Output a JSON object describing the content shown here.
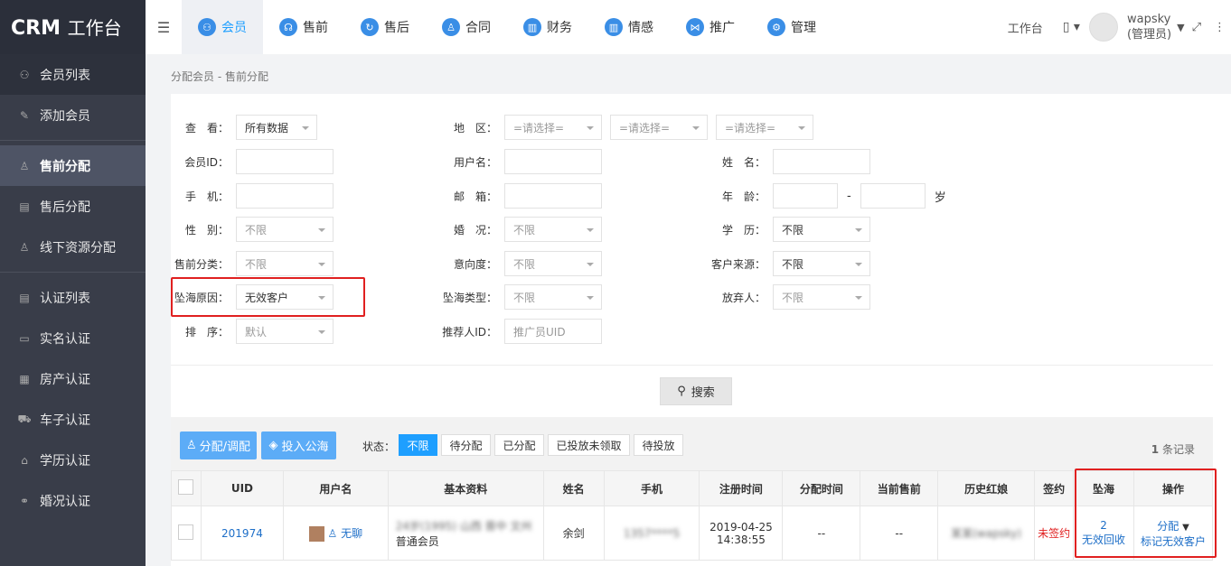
{
  "app": {
    "logo_main": "CRM",
    "logo_sub": "工作台"
  },
  "sidebar": {
    "items": [
      {
        "label": "会员列表",
        "icon": "members-icon"
      },
      {
        "label": "添加会员",
        "icon": "edit-icon"
      },
      {
        "label": "售前分配",
        "icon": "user-icon"
      },
      {
        "label": "售后分配",
        "icon": "doc-icon"
      },
      {
        "label": "线下资源分配",
        "icon": "user-add-icon"
      },
      {
        "label": "认证列表",
        "icon": "list-icon"
      },
      {
        "label": "实名认证",
        "icon": "id-card-icon"
      },
      {
        "label": "房产认证",
        "icon": "house-icon"
      },
      {
        "label": "车子认证",
        "icon": "car-icon"
      },
      {
        "label": "学历认证",
        "icon": "graduation-icon"
      },
      {
        "label": "婚况认证",
        "icon": "ring-icon"
      }
    ],
    "active_index": 2
  },
  "topnav": {
    "tabs": [
      "会员",
      "售前",
      "售后",
      "合同",
      "财务",
      "情感",
      "推广",
      "管理"
    ],
    "active_index": 0,
    "workbench": "工作台",
    "username": "wapsky",
    "role": "(管理员)"
  },
  "breadcrumb": "分配会员 - 售前分配",
  "filters": {
    "view": {
      "label": "查　看：",
      "value": "所有数据"
    },
    "region": {
      "label": "地　区：",
      "options": [
        "=请选择=",
        "=请选择=",
        "=请选择="
      ]
    },
    "member_id": {
      "label": "会员ID："
    },
    "username": {
      "label": "用户名："
    },
    "name": {
      "label": "姓　名："
    },
    "phone": {
      "label": "手　机："
    },
    "email": {
      "label": "邮　箱："
    },
    "age": {
      "label": "年　龄：",
      "sep": "-",
      "unit": "岁"
    },
    "gender": {
      "label": "性　别：",
      "value": "不限"
    },
    "marriage": {
      "label": "婚　况：",
      "value": "不限"
    },
    "education": {
      "label": "学　历：",
      "value": "不限"
    },
    "presale_class": {
      "label": "售前分类：",
      "value": "不限"
    },
    "intent": {
      "label": "意向度：",
      "value": "不限"
    },
    "source": {
      "label": "客户来源：",
      "value": "不限"
    },
    "sea_reason": {
      "label": "坠海原因：",
      "value": "无效客户"
    },
    "sea_type": {
      "label": "坠海类型：",
      "value": "不限"
    },
    "abandoner": {
      "label": "放弃人：",
      "value": "不限"
    },
    "sort": {
      "label": "排　序：",
      "value": "默认"
    },
    "referrer": {
      "label": "推荐人ID：",
      "placeholder": "推广员UID"
    },
    "search_btn": "搜索"
  },
  "toolbar": {
    "assign_btn": "分配/调配",
    "public_btn": "投入公海",
    "status_label": "状态：",
    "status_options": [
      "不限",
      "待分配",
      "已分配",
      "已投放未领取",
      "待投放"
    ],
    "status_active": 0,
    "record_count": "1",
    "record_suffix": "条记录"
  },
  "table": {
    "headers": [
      "UID",
      "用户名",
      "基本资料",
      "姓名",
      "手机",
      "注册时间",
      "分配时间",
      "当前售前",
      "历史红娘",
      "签约",
      "坠海",
      "操作"
    ],
    "rows": [
      {
        "uid": "201974",
        "username": "无聊",
        "profile_line1": "24岁(1995) 山西 晋中 文州",
        "profile_line2": "普通会员",
        "name": "余剑",
        "phone": "1357****5",
        "reg_date": "2019-04-25",
        "reg_time": "14:38:55",
        "assign_time": "--",
        "current_presale": "--",
        "history_matchmaker": "某某(wapsky)",
        "sign": "未签约",
        "sea_count": "2",
        "sea_reason": "无效回收",
        "action_assign": "分配",
        "action_mark": "标记无效客户"
      }
    ]
  }
}
